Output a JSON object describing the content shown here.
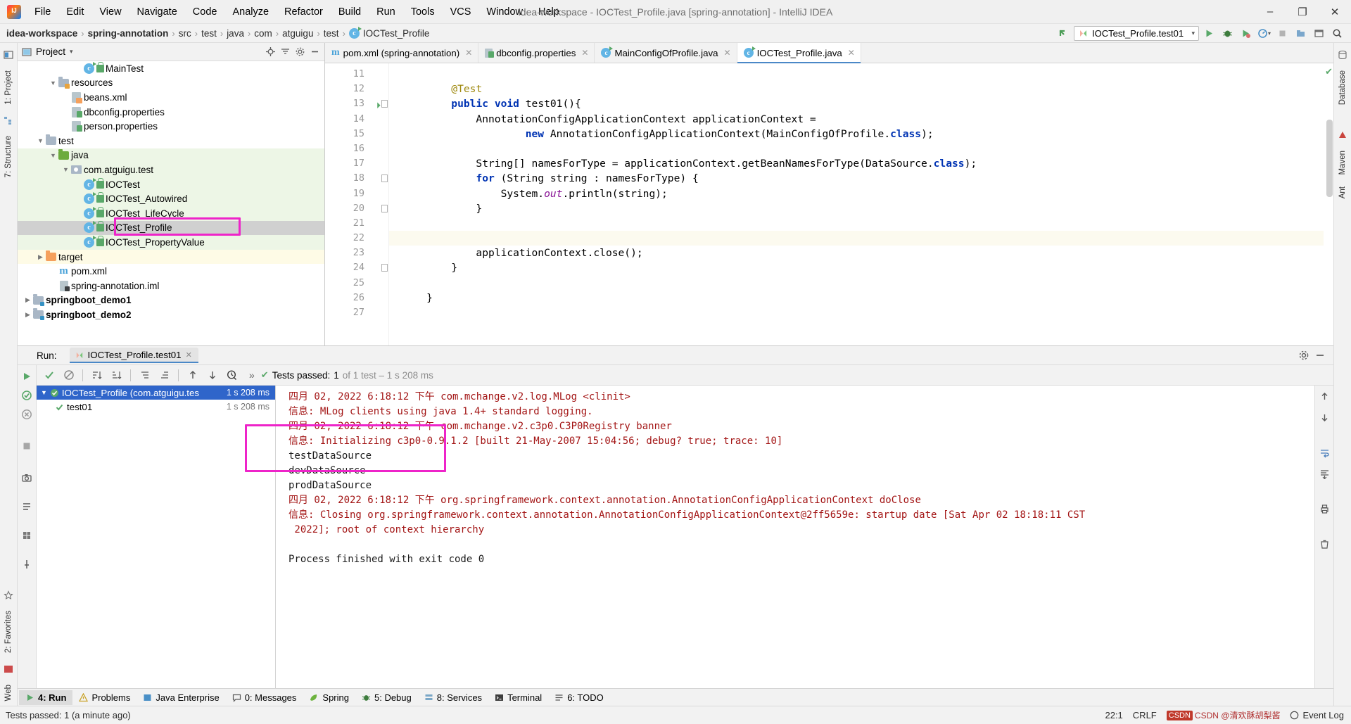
{
  "window": {
    "title": "idea-workspace - IOCTest_Profile.java [spring-annotation] - IntelliJ IDEA",
    "minimize": "–",
    "maximize": "❐",
    "close": "✕"
  },
  "menubar": {
    "items": [
      "File",
      "Edit",
      "View",
      "Navigate",
      "Code",
      "Analyze",
      "Refactor",
      "Build",
      "Run",
      "Tools",
      "VCS",
      "Window",
      "Help"
    ]
  },
  "breadcrumb": {
    "items": [
      {
        "label": "idea-workspace",
        "bold": true
      },
      {
        "label": "spring-annotation",
        "bold": true
      },
      {
        "label": "src",
        "bold": false
      },
      {
        "label": "test",
        "bold": false
      },
      {
        "label": "java",
        "bold": false
      },
      {
        "label": "com",
        "bold": false
      },
      {
        "label": "atguigu",
        "bold": false
      },
      {
        "label": "test",
        "bold": false
      },
      {
        "label": "IOCTest_Profile",
        "bold": false,
        "icon": "class-icon"
      }
    ],
    "separator": "›"
  },
  "toolbar": {
    "run_configuration": "IOCTest_Profile.test01",
    "dropdown_arrow": "▾",
    "buttons": [
      "run-button",
      "debug-button",
      "run-with-coverage-button",
      "profiler-button",
      "stop-button",
      "build-button",
      "search-everywhere-button"
    ]
  },
  "sidebar_left": {
    "tabs": [
      "1: Project",
      "7: Structure",
      "2: Favorites",
      "Web"
    ]
  },
  "sidebar_right": {
    "tabs": [
      "Database",
      "Maven",
      "Ant"
    ]
  },
  "project_panel": {
    "title": "Project",
    "dropdown": "▾",
    "tree": [
      {
        "indent": 4,
        "label": "MainTest",
        "icon": "class-icon",
        "lock": true,
        "arrow": "",
        "bg": "white"
      },
      {
        "indent": 2,
        "label": "resources",
        "icon": "folder-resources-icon",
        "arrow": "▼",
        "bg": "white"
      },
      {
        "indent": 3,
        "label": "beans.xml",
        "icon": "xml-file-icon",
        "arrow": "",
        "bg": "white"
      },
      {
        "indent": 3,
        "label": "dbconfig.properties",
        "icon": "properties-file-icon",
        "arrow": "",
        "bg": "white"
      },
      {
        "indent": 3,
        "label": "person.properties",
        "icon": "properties-file-icon",
        "arrow": "",
        "bg": "white"
      },
      {
        "indent": 1,
        "label": "test",
        "icon": "folder-icon",
        "arrow": "▼",
        "bg": "white"
      },
      {
        "indent": 2,
        "label": "java",
        "icon": "folder-source-icon",
        "arrow": "▼",
        "bg": "green"
      },
      {
        "indent": 3,
        "label": "com.atguigu.test",
        "icon": "package-icon",
        "arrow": "▼",
        "bg": "green"
      },
      {
        "indent": 4,
        "label": "IOCTest",
        "icon": "class-icon",
        "lock": true,
        "arrow": "",
        "bg": "green"
      },
      {
        "indent": 4,
        "label": "IOCTest_Autowired",
        "icon": "class-icon",
        "lock": true,
        "arrow": "",
        "bg": "green"
      },
      {
        "indent": 4,
        "label": "IOCTest_LifeCycle",
        "icon": "class-icon",
        "lock": true,
        "arrow": "",
        "bg": "green"
      },
      {
        "indent": 4,
        "label": "IOCTest_Profile",
        "icon": "class-icon",
        "lock": true,
        "arrow": "",
        "bg": "selected"
      },
      {
        "indent": 4,
        "label": "IOCTest_PropertyValue",
        "icon": "class-icon",
        "lock": true,
        "arrow": "",
        "bg": "green"
      },
      {
        "indent": 1,
        "label": "target",
        "icon": "folder-target-icon",
        "arrow": "▶",
        "bg": "yellow"
      },
      {
        "indent": 2,
        "label": "pom.xml",
        "icon": "maven-icon",
        "arrow": "",
        "bg": "white"
      },
      {
        "indent": 2,
        "label": "spring-annotation.iml",
        "icon": "iml-file-icon",
        "arrow": "",
        "bg": "white"
      },
      {
        "indent": 0,
        "label": "springboot_demo1",
        "icon": "module-icon",
        "arrow": "▶",
        "bg": "white",
        "bold": true
      },
      {
        "indent": 0,
        "label": "springboot_demo2",
        "icon": "module-icon",
        "arrow": "▶",
        "bg": "white",
        "bold": true
      }
    ]
  },
  "editor": {
    "tabs": [
      {
        "label": "pom.xml (spring-annotation)",
        "icon": "maven-icon",
        "active": false
      },
      {
        "label": "dbconfig.properties",
        "icon": "properties-file-icon",
        "active": false
      },
      {
        "label": "MainConfigOfProfile.java",
        "icon": "class-icon",
        "active": false
      },
      {
        "label": "IOCTest_Profile.java",
        "icon": "class-icon",
        "active": true
      }
    ],
    "close_glyph": "✕",
    "lines": [
      {
        "no": "11",
        "html": "",
        "current": false
      },
      {
        "no": "12",
        "html": "        <span class=\"ann\">@Test</span>",
        "current": false
      },
      {
        "no": "13",
        "html": "        <span class=\"kw\">public</span> <span class=\"kw\">void</span> test01(){",
        "current": false,
        "runmark": true,
        "fold": "open"
      },
      {
        "no": "14",
        "html": "            AnnotationConfigApplicationContext applicationContext =",
        "current": false
      },
      {
        "no": "15",
        "html": "                    <span class=\"kw\">new</span> AnnotationConfigApplicationContext(MainConfigOfProfile.<span class=\"kw\">class</span>);",
        "current": false
      },
      {
        "no": "16",
        "html": "",
        "current": false
      },
      {
        "no": "17",
        "html": "            String[] namesForType = applicationContext.getBeanNamesForType(DataSource.<span class=\"kw\">class</span>);",
        "current": false
      },
      {
        "no": "18",
        "html": "            <span class=\"kw\">for</span> (String string : namesForType) {",
        "current": false,
        "fold": "open"
      },
      {
        "no": "19",
        "html": "                System.<span class=\"fld\">out</span>.println(string);",
        "current": false
      },
      {
        "no": "20",
        "html": "            }",
        "current": false,
        "fold": "close"
      },
      {
        "no": "21",
        "html": "",
        "current": false
      },
      {
        "no": "22",
        "html": "",
        "current": true
      },
      {
        "no": "23",
        "html": "            applicationContext.close();",
        "current": false
      },
      {
        "no": "24",
        "html": "        }",
        "current": false,
        "fold": "close"
      },
      {
        "no": "25",
        "html": "",
        "current": false
      },
      {
        "no": "26",
        "html": "    }",
        "current": false
      },
      {
        "no": "27",
        "html": "",
        "current": false
      }
    ]
  },
  "run_panel": {
    "label": "Run:",
    "tab_label": "IOCTest_Profile.test01",
    "tab_close": "✕",
    "settings_icon": "gear-icon",
    "minimize_icon": "minimize-icon",
    "toolbar_buttons": [
      "rerun-button",
      "rerun-failed-tests-button",
      "stop-button",
      "camera-button",
      "pin-button",
      "trash-button"
    ],
    "test_toolbar_buttons": [
      "show-passed-button",
      "hide-ignored-button",
      "sort-alphabetically-button",
      "sort-by-duration-button",
      "expand-all-button",
      "collapse-all-button",
      "prev-button",
      "next-button",
      "history-button"
    ],
    "overflow": "»",
    "tests_status": {
      "prefix": "Tests passed:",
      "count": "1",
      "suffix": "of 1 test – 1 s 208 ms",
      "check": "✔"
    },
    "test_tree": [
      {
        "label": "IOCTest_Profile (com.atguigu.tes",
        "duration": "1 s 208 ms",
        "selected": true,
        "icon": "expand-icon"
      },
      {
        "label": "test01",
        "duration": "1 s 208 ms",
        "selected": false,
        "icon": "test-passed-icon"
      }
    ],
    "console": [
      {
        "text": "四月 02, 2022 6:18:12 下午 com.mchange.v2.log.MLog <clinit>",
        "type": "err"
      },
      {
        "text": "信息: MLog clients using java 1.4+ standard logging.",
        "type": "err"
      },
      {
        "text": "四月 02, 2022 6:18:12 下午 com.mchange.v2.c3p0.C3P0Registry banner",
        "type": "err"
      },
      {
        "text": "信息: Initializing c3p0-0.9.1.2 [built 21-May-2007 15:04:56; debug? true; trace: 10]",
        "type": "err"
      },
      {
        "text": "testDataSource",
        "type": "out"
      },
      {
        "text": "devDataSource",
        "type": "out"
      },
      {
        "text": "prodDataSource",
        "type": "out"
      },
      {
        "text": "四月 02, 2022 6:18:12 下午 org.springframework.context.annotation.AnnotationConfigApplicationContext doClose",
        "type": "err"
      },
      {
        "text": "信息: Closing org.springframework.context.annotation.AnnotationConfigApplicationContext@2ff5659e: startup date [Sat Apr 02 18:18:11 CST",
        "type": "err"
      },
      {
        "text": " 2022]; root of context hierarchy",
        "type": "err"
      },
      {
        "text": "",
        "type": "out"
      },
      {
        "text": "Process finished with exit code 0",
        "type": "proc"
      }
    ],
    "console_side_buttons": [
      "scroll-up-button",
      "scroll-down-button",
      "soft-wrap-button",
      "scroll-to-end-button",
      "print-button",
      "clear-all-button"
    ]
  },
  "bottom_tabs": [
    {
      "label": "4: Run",
      "icon": "run-icon",
      "active": true
    },
    {
      "label": "Problems",
      "icon": "warning-icon",
      "active": false
    },
    {
      "label": "Java Enterprise",
      "icon": "java-icon",
      "active": false
    },
    {
      "label": "0: Messages",
      "icon": "messages-icon",
      "active": false
    },
    {
      "label": "Spring",
      "icon": "spring-leaf-icon",
      "active": false
    },
    {
      "label": "5: Debug",
      "icon": "debug-icon",
      "active": false
    },
    {
      "label": "8: Services",
      "icon": "services-icon",
      "active": false
    },
    {
      "label": "Terminal",
      "icon": "terminal-icon",
      "active": false
    },
    {
      "label": "6: TODO",
      "icon": "todo-icon",
      "active": false
    }
  ],
  "statusbar": {
    "message": "Tests passed: 1 (a minute ago)",
    "caret": "22:1",
    "encoding": "CRLF",
    "event_log": "Event Log",
    "watermark": "CSDN @清欢酥胡梨酱"
  },
  "annotations": {
    "box_color": "#ee24c9",
    "boxes": [
      "project-tree-IOCTest_Profile",
      "console-datasource-output"
    ]
  }
}
